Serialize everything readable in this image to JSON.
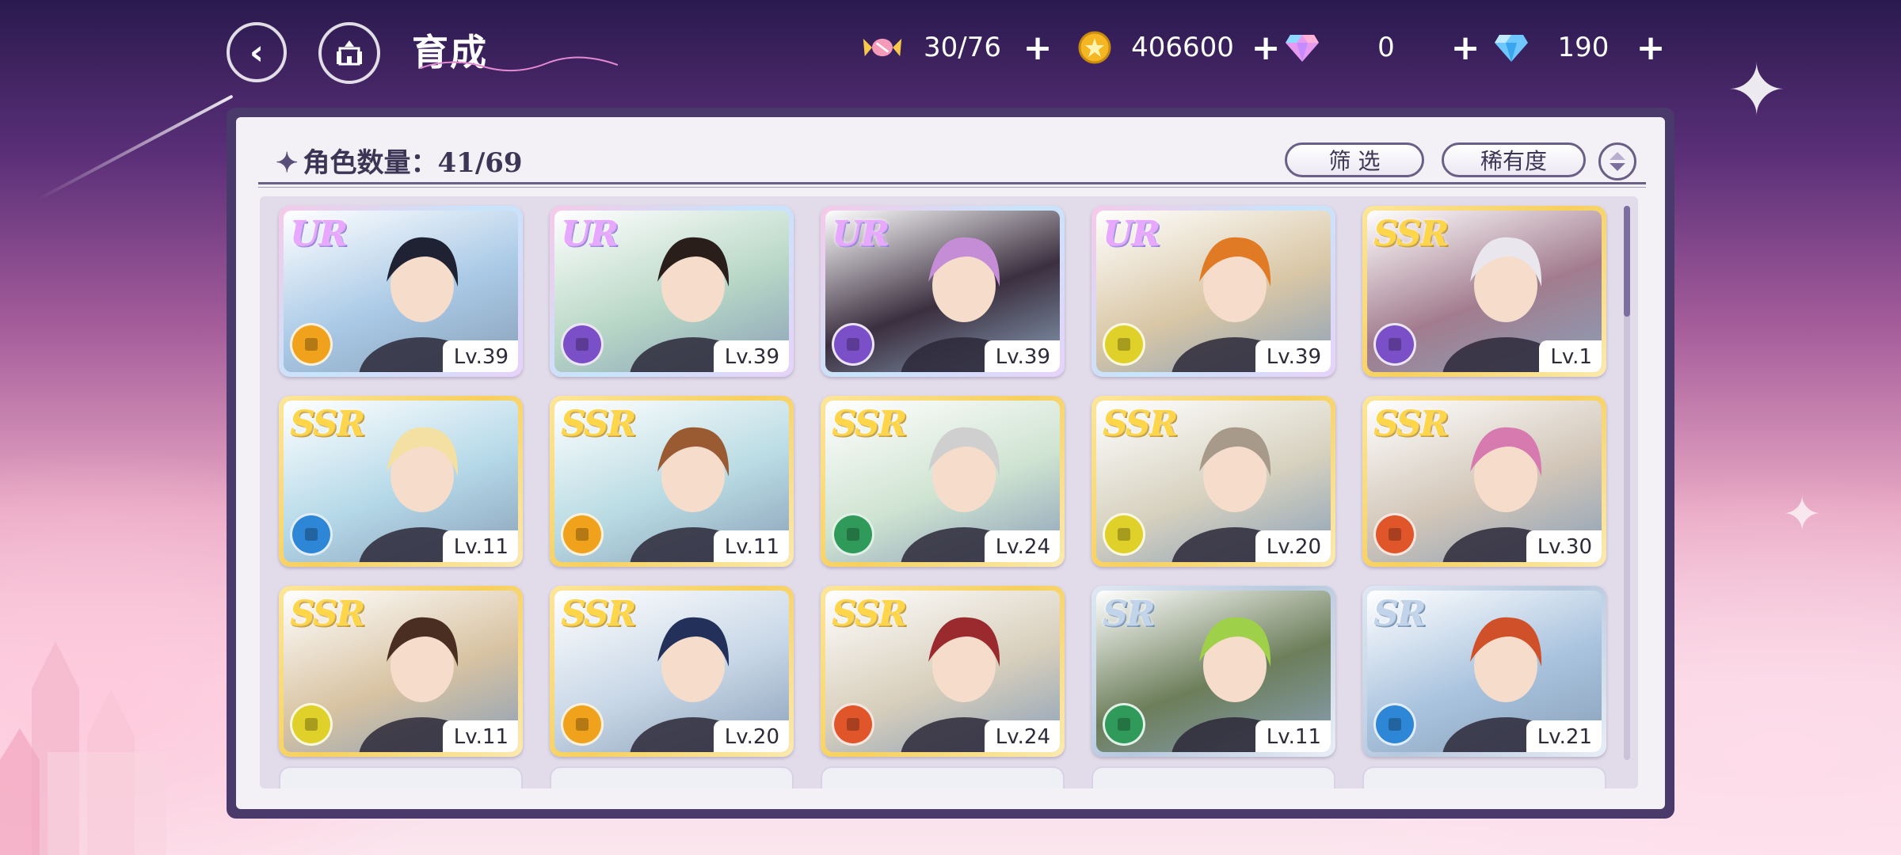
{
  "header": {
    "title": "育成",
    "resources": [
      {
        "icon": "candy-icon",
        "value": "30/76"
      },
      {
        "icon": "gold-coin-icon",
        "value": "406600"
      },
      {
        "icon": "rainbow-diamond-icon",
        "value": "0"
      },
      {
        "icon": "blue-diamond-icon",
        "value": "190"
      }
    ]
  },
  "panel": {
    "count_label": "角色数量：41/69",
    "filter_label": "筛 选",
    "rarity_sort_label": "稀有度"
  },
  "cards": [
    {
      "rarity": "UR",
      "level": "Lv.39",
      "attr_color": "#f0a21c",
      "bg": "#a9c9e6",
      "hair": "#1f2233"
    },
    {
      "rarity": "UR",
      "level": "Lv.39",
      "attr_color": "#7b4fc7",
      "bg": "#b8d7c6",
      "hair": "#2a1e1a"
    },
    {
      "rarity": "UR",
      "level": "Lv.39",
      "attr_color": "#7b4fc7",
      "bg": "#3b2f3f",
      "hair": "#c48dd6"
    },
    {
      "rarity": "UR",
      "level": "Lv.39",
      "attr_color": "#e0d12a",
      "bg": "#d9c7a6",
      "hair": "#e07a24"
    },
    {
      "rarity": "SSR",
      "level": "Lv.1",
      "attr_color": "#7b4fc7",
      "bg": "#a27c8e",
      "hair": "#e9e6ee"
    },
    {
      "rarity": "SSR",
      "level": "Lv.11",
      "attr_color": "#2e86d6",
      "bg": "#b4d8e8",
      "hair": "#f3e0a2"
    },
    {
      "rarity": "SSR",
      "level": "Lv.11",
      "attr_color": "#f0a21c",
      "bg": "#b9dbe3",
      "hair": "#9a5a32"
    },
    {
      "rarity": "SSR",
      "level": "Lv.24",
      "attr_color": "#2f9a5a",
      "bg": "#cfe3d1",
      "hair": "#cfcfcf"
    },
    {
      "rarity": "SSR",
      "level": "Lv.20",
      "attr_color": "#e0d12a",
      "bg": "#d6d1bf",
      "hair": "#a79a8a"
    },
    {
      "rarity": "SSR",
      "level": "Lv.30",
      "attr_color": "#e0552a",
      "bg": "#d2c6b8",
      "hair": "#d67ab0"
    },
    {
      "rarity": "SSR",
      "level": "Lv.11",
      "attr_color": "#e0d12a",
      "bg": "#d8c3a2",
      "hair": "#4a2e22"
    },
    {
      "rarity": "SSR",
      "level": "Lv.20",
      "attr_color": "#f0a21c",
      "bg": "#c7d6e6",
      "hair": "#22305a"
    },
    {
      "rarity": "SSR",
      "level": "Lv.24",
      "attr_color": "#e0552a",
      "bg": "#d8cfbc",
      "hair": "#9a2a2e"
    },
    {
      "rarity": "SR",
      "level": "Lv.11",
      "attr_color": "#2f9a5a",
      "bg": "#6c7e5a",
      "hair": "#9fd04a"
    },
    {
      "rarity": "SR",
      "level": "Lv.21",
      "attr_color": "#2e86d6",
      "bg": "#a9c3de",
      "hair": "#d0502a"
    }
  ],
  "colors": {
    "panel_frame": "#4a3a6c",
    "panel_bg": "#f4f1f6",
    "text_dark": "#3d3555"
  }
}
